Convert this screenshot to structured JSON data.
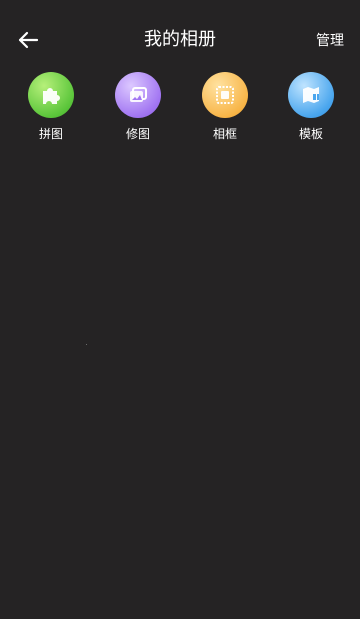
{
  "header": {
    "title": "我的相册",
    "manage_label": "管理"
  },
  "tools": [
    {
      "label": "拼图",
      "icon": "puzzle-icon"
    },
    {
      "label": "修图",
      "icon": "photo-edit-icon"
    },
    {
      "label": "相框",
      "icon": "frame-icon"
    },
    {
      "label": "模板",
      "icon": "template-icon"
    }
  ],
  "colors": {
    "background": "#252324",
    "text": "#ffffff",
    "puzzle": "#5cc63b",
    "edit": "#a276f2",
    "frame": "#f8b64a",
    "template": "#4aa6ee"
  }
}
